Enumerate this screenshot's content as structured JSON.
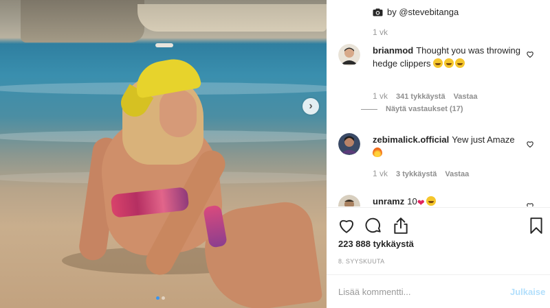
{
  "caption": {
    "credit": "by @stevebitanga",
    "time": "1 vk"
  },
  "comments": [
    {
      "username": "brianmod",
      "text": "Thought you was throwing hedge clippers",
      "emojis": [
        "laughing-emoji",
        "laughing-emoji",
        "laughing-emoji"
      ],
      "time": "1 vk",
      "likes": "341 tykkäystä",
      "reply": "Vastaa",
      "view_replies": "Näytä vastaukset (17)"
    },
    {
      "username": "zebimalick.official",
      "text": "Yew just Amaze",
      "emojis": [
        "fire-emoji"
      ],
      "time": "1 vk",
      "likes": "3 tykkäystä",
      "reply": "Vastaa"
    },
    {
      "username": "unramz",
      "text": "10",
      "emojis": [
        "red-heart-emoji",
        "scream-emoji"
      ]
    }
  ],
  "post": {
    "likes": "223 888 tykkäystä",
    "date": "8. SYYSKUUTA"
  },
  "add_comment": {
    "placeholder": "Lisää kommentti...",
    "post_label": "Julkaise"
  },
  "colors": {
    "accent": "#3897f0",
    "post_disabled": "#b2dffc",
    "heart": "#e0245e"
  },
  "icons": {
    "like": "heart-outline-icon",
    "comment": "speech-bubble-icon",
    "share": "share-icon",
    "save": "bookmark-icon",
    "next": "chevron-right-icon",
    "camera": "camera-icon"
  }
}
